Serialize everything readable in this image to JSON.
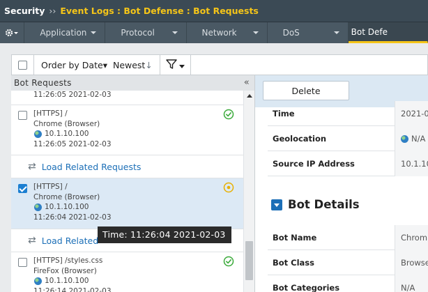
{
  "header": {
    "section": "Security",
    "separator": "››",
    "breadcrumb": "Event Logs : Bot Defense : Bot Requests"
  },
  "tabs": [
    {
      "label": "Application"
    },
    {
      "label": "Protocol"
    },
    {
      "label": "Network"
    },
    {
      "label": "DoS"
    },
    {
      "label": "Bot Defe"
    }
  ],
  "toolbar": {
    "order_label": "Order by Date",
    "order_caret": "▾",
    "sort_label": "Newest",
    "sort_arrow": "↓"
  },
  "left_panel": {
    "title": "Bot Requests",
    "collapse_glyph": "«",
    "top_partial_time": "11:26:05 2021-02-03",
    "items": [
      {
        "request": "[HTTPS] /",
        "browser": "Chrome (Browser)",
        "ip": "10.1.10.100",
        "time": "11:26:05 2021-02-03",
        "status": "ok",
        "checked": false
      },
      {
        "request": "[HTTPS] /",
        "browser": "Chrome (Browser)",
        "ip": "10.1.10.100",
        "time": "11:26:04 2021-02-03",
        "status": "pending",
        "checked": true
      },
      {
        "request": "[HTTPS] /styles.css",
        "browser": "FireFox (Browser)",
        "ip": "10.1.10.100",
        "time": "11:26:14 2021-02-03",
        "status": "ok",
        "checked": false
      }
    ],
    "load_related_1": "Load Related Requests",
    "load_related_2": "Load Related",
    "tooltip": "Time: 11:26:04 2021-02-03"
  },
  "right_panel": {
    "delete_label": "Delete",
    "rows_top": [
      {
        "key": "Time",
        "value": "2021-0"
      },
      {
        "key": "Geolocation",
        "value": "N/A"
      },
      {
        "key": "Source IP Address",
        "value": "10.1.10"
      }
    ],
    "section_title": "Bot Details",
    "rows_bottom": [
      {
        "key": "Bot Name",
        "value": "Chrom"
      },
      {
        "key": "Bot Class",
        "value": "Browse"
      },
      {
        "key": "Bot Categories",
        "value": "N/A"
      }
    ]
  },
  "colors": {
    "accent": "#f5c518",
    "link": "#1c6fb7",
    "ok": "#3aaa3a",
    "pending": "#e8b000"
  }
}
